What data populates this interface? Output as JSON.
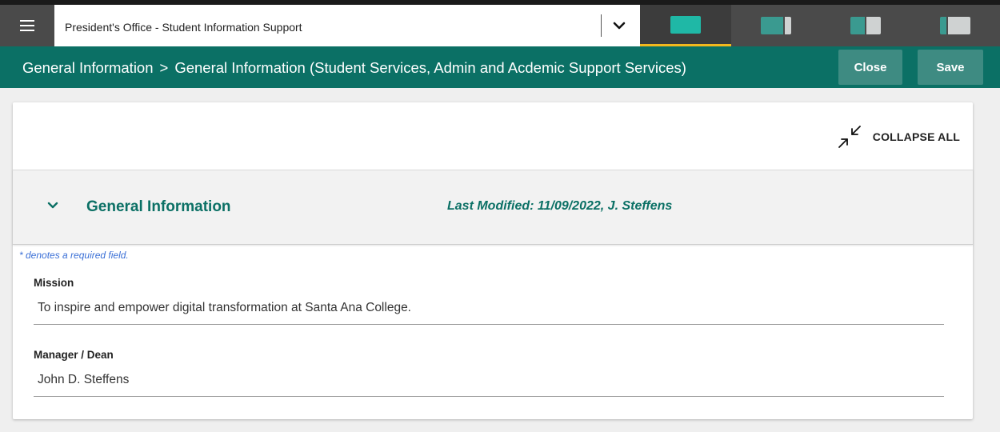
{
  "topbar": {
    "selector_value": "President's Office - Student Information Support",
    "views": [
      {
        "name": "view-1",
        "active": true
      },
      {
        "name": "view-2",
        "active": false
      },
      {
        "name": "view-3",
        "active": false
      },
      {
        "name": "view-4",
        "active": false
      }
    ]
  },
  "header": {
    "breadcrumb_parent": "General Information",
    "breadcrumb_separator": ">",
    "breadcrumb_current": "General Information (Student Services, Admin and Acdemic Support Services)",
    "close_label": "Close",
    "save_label": "Save"
  },
  "card": {
    "collapse_all_label": "COLLAPSE ALL",
    "section": {
      "title": "General Information",
      "last_modified": "Last Modified: 11/09/2022, J. Steffens"
    },
    "required_note": "* denotes a required field.",
    "fields": [
      {
        "label": "Mission",
        "value": "To inspire and empower digital transformation at Santa Ana College."
      },
      {
        "label": "Manager / Dean",
        "value": "John D. Steffens"
      }
    ]
  },
  "colors": {
    "accent": "#0b7065",
    "topbar": "#3c3c3c",
    "active_underline": "#f2b81e",
    "button": "#3e8b82",
    "view_teal": "#1fb8a6",
    "view_teal_dark": "#3a9a90",
    "view_gray": "#cfd2d2"
  }
}
